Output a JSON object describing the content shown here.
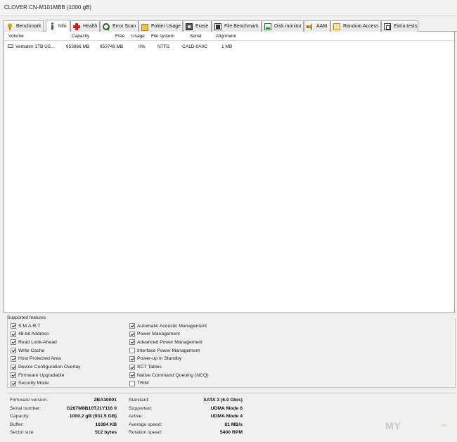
{
  "window": {
    "title": "CLOVER  CN-M101MBB (1000 gB)"
  },
  "tabs": [
    {
      "label": "Benchmark",
      "icon": "benchmark-icon"
    },
    {
      "label": "Info",
      "icon": "info-icon"
    },
    {
      "label": "Health",
      "icon": "health-icon"
    },
    {
      "label": "Error Scan",
      "icon": "error-scan-icon"
    },
    {
      "label": "Folder Usage",
      "icon": "folder-icon"
    },
    {
      "label": "Erase",
      "icon": "erase-icon"
    },
    {
      "label": "File Benchmark",
      "icon": "file-benchmark-icon"
    },
    {
      "label": "Disk monitor",
      "icon": "disk-monitor-icon"
    },
    {
      "label": "AAM",
      "icon": "speaker-icon"
    },
    {
      "label": "Random Access",
      "icon": "random-access-icon"
    },
    {
      "label": "Extra tests",
      "icon": "extra-tests-icon"
    }
  ],
  "volumes": {
    "headers": [
      "Volume",
      "Capacity",
      "Free",
      "Usage",
      "File system",
      "Serial",
      "Alignment"
    ],
    "rows": [
      {
        "volume": "Verbatim 1TB US...",
        "capacity": "953866 MB",
        "free": "953748 MB",
        "usage": "0%",
        "filesystem": "NTFS",
        "serial": "CA1D-0A0C",
        "alignment": "1 MB"
      }
    ]
  },
  "features": {
    "title": "Supported features",
    "left": [
      {
        "label": "S.M.A.R.T",
        "checked": true
      },
      {
        "label": "48-bit Address",
        "checked": true
      },
      {
        "label": "Read Look-Ahead",
        "checked": true
      },
      {
        "label": "Write Cache",
        "checked": true
      },
      {
        "label": "Host Protected Area",
        "checked": true
      },
      {
        "label": "Device Configuration Overlay",
        "checked": true
      },
      {
        "label": "Firmware Upgradable",
        "checked": true
      },
      {
        "label": "Security Mode",
        "checked": true
      }
    ],
    "right": [
      {
        "label": "Automatic Acoustic Management",
        "checked": true
      },
      {
        "label": "Power Management",
        "checked": true
      },
      {
        "label": "Advanced Power Management",
        "checked": true
      },
      {
        "label": "Interface Power Management",
        "checked": false
      },
      {
        "label": "Power-up in Standby",
        "checked": true
      },
      {
        "label": "SCT Tables",
        "checked": true
      },
      {
        "label": "Native Command Queuing (NCQ)",
        "checked": true
      },
      {
        "label": "TRIM",
        "checked": false
      }
    ]
  },
  "details": {
    "left": [
      {
        "label": "Firmware version:",
        "value": "2BA30001"
      },
      {
        "label": "Serial number:",
        "value": "G267M8B10TJ1Y116 0"
      },
      {
        "label": "Capacity:",
        "value": "1000.2 gB (931.5 GB)"
      },
      {
        "label": "Buffer:",
        "value": "16384 KB"
      },
      {
        "label": "Sector size",
        "value": "512 bytes"
      }
    ],
    "right": [
      {
        "label": "Standard:",
        "value": "SATA 3 (6.0 Gb/s)"
      },
      {
        "label": "Supported:",
        "value": "UDMA Mode 6"
      },
      {
        "label": "Active:",
        "value": "UDMA Mode 4"
      },
      {
        "label": "Average speed:",
        "value": "81 MB/s"
      },
      {
        "label": "Rotation speed:",
        "value": "5400 RPM"
      }
    ]
  },
  "watermark": {
    "main": "MY",
    "small": ".ru"
  }
}
